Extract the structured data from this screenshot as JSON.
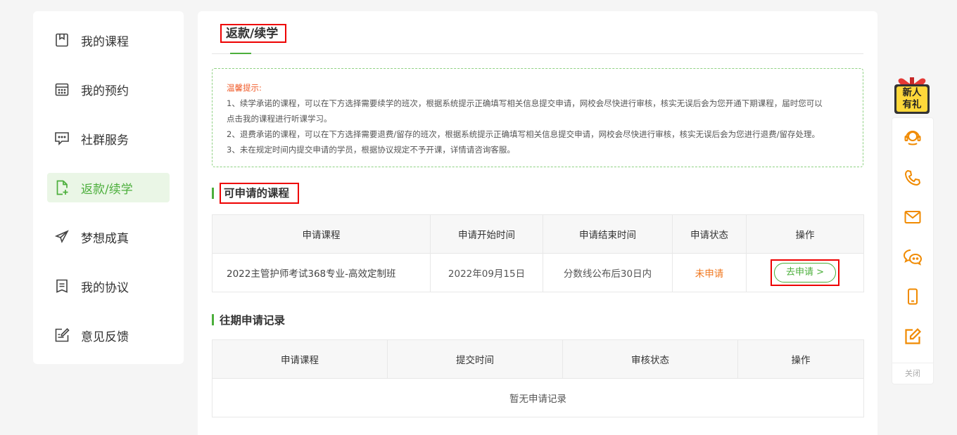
{
  "sidebar": {
    "items": [
      {
        "label": "我的课程",
        "icon": "bookmark-icon"
      },
      {
        "label": "我的预约",
        "icon": "calendar-icon"
      },
      {
        "label": "社群服务",
        "icon": "chat-icon"
      },
      {
        "label": "返款/续学",
        "icon": "file-add-icon",
        "active": true
      },
      {
        "label": "梦想成真",
        "icon": "paper-plane-icon"
      },
      {
        "label": "我的协议",
        "icon": "document-icon"
      },
      {
        "label": "意见反馈",
        "icon": "edit-icon"
      }
    ]
  },
  "main": {
    "title": "返款/续学",
    "notice": {
      "title": "温馨提示:",
      "line1": "1、续学承诺的课程，可以在下方选择需要续学的班次，根据系统提示正确填写相关信息提交申请，网校会尽快进行审核，核实无误后会为您开通下期课程，届时您可以",
      "line1b": "点击我的课程进行听课学习。",
      "line2": "2、退费承诺的课程，可以在下方选择需要退费/留存的班次，根据系统提示正确填写相关信息提交申请，网校会尽快进行审核，核实无误后会为您进行退费/留存处理。",
      "line3": "3、未在规定时间内提交申请的学员，根据协议规定不予开课，详情请咨询客服。"
    },
    "available": {
      "title": "可申请的课程",
      "headers": [
        "申请课程",
        "申请开始时间",
        "申请结束时间",
        "申请状态",
        "操作"
      ],
      "row": {
        "course": "2022主管护师考试368专业-高效定制班",
        "start": "2022年09月15日",
        "end": "分数线公布后30日内",
        "status": "未申请",
        "action": "去申请 >"
      }
    },
    "history": {
      "title": "往期申请记录",
      "headers": [
        "申请课程",
        "提交时间",
        "审核状态",
        "操作"
      ],
      "empty": "暂无申请记录"
    }
  },
  "float_bar": {
    "gift_text_1": "新人",
    "gift_text_2": "有礼",
    "items": [
      "headset-icon",
      "phone-icon",
      "mail-icon",
      "wechat-icon",
      "mobile-icon",
      "edit-icon"
    ],
    "close_label": "关闭"
  },
  "colors": {
    "accent": "#4caf3c",
    "warning": "#f07820",
    "icon_orange": "#f08a00",
    "highlight_box": "#e00000"
  }
}
